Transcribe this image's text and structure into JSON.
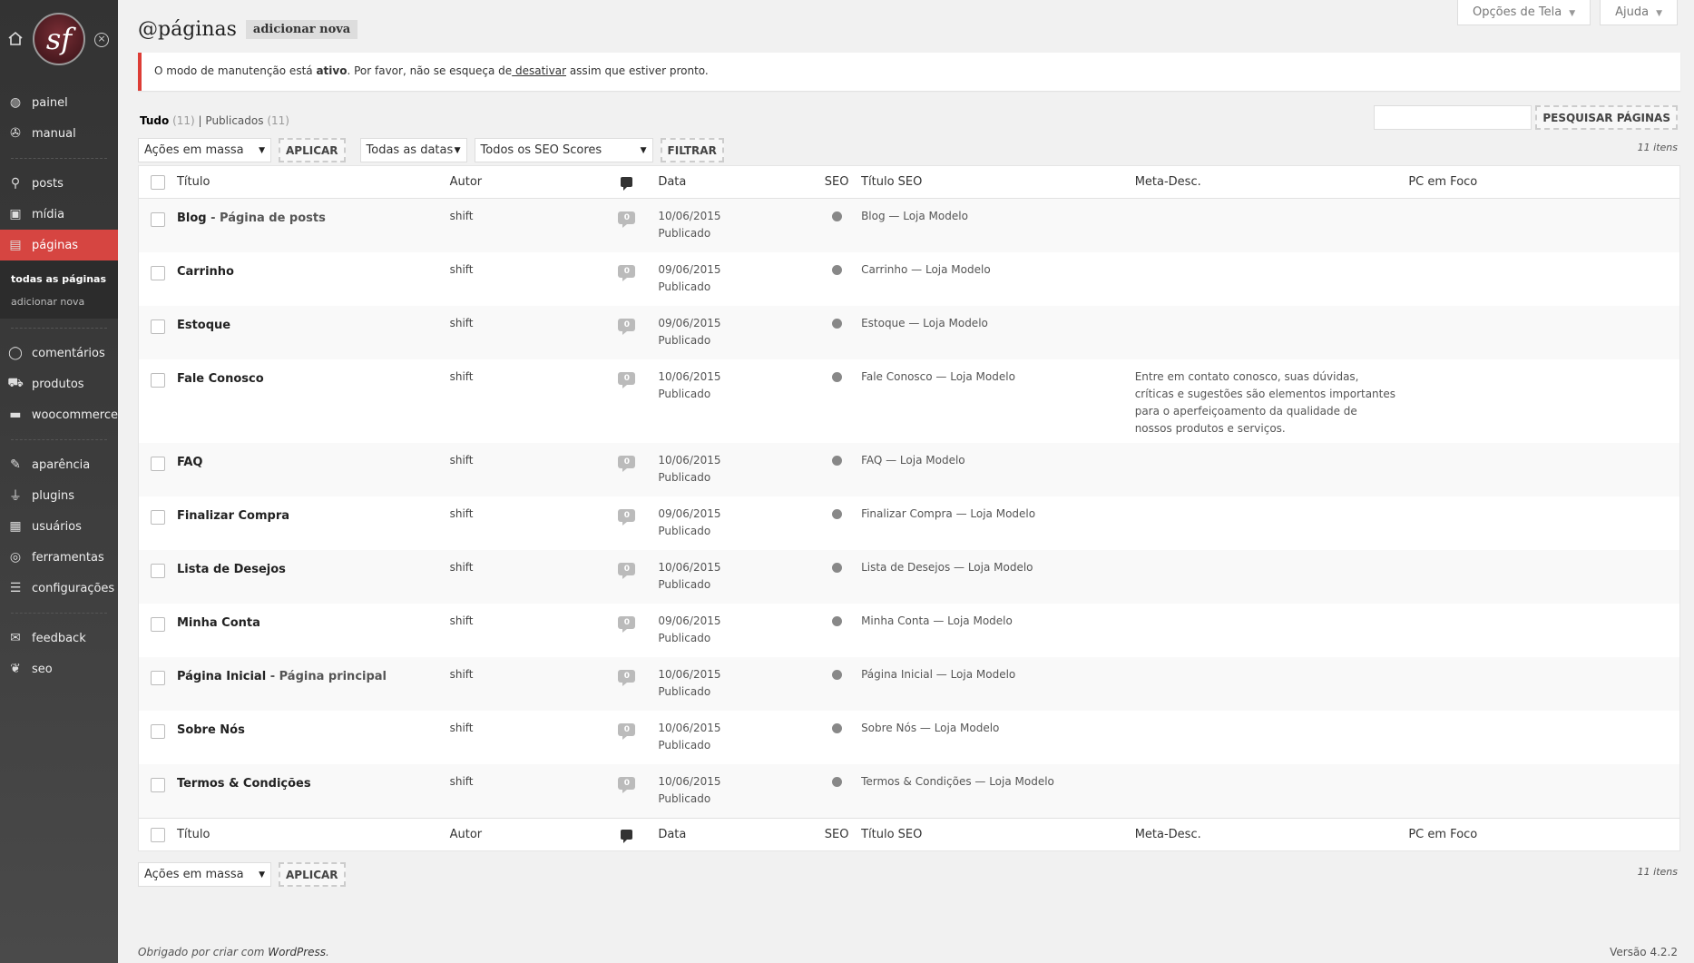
{
  "sidebar": {
    "logo_text": "sf",
    "groups": [
      [
        {
          "label": "painel",
          "icon": "globe-icon"
        },
        {
          "label": "manual",
          "icon": "lifebuoy-icon"
        }
      ],
      [
        {
          "label": "posts",
          "icon": "pin-icon"
        },
        {
          "label": "mídia",
          "icon": "media-icon"
        },
        {
          "label": "páginas",
          "icon": "page-icon",
          "active": true
        }
      ],
      [
        {
          "label": "comentários",
          "icon": "comment-icon"
        },
        {
          "label": "produtos",
          "icon": "cart-icon"
        },
        {
          "label": "woocommerce",
          "icon": "woo-icon"
        }
      ],
      [
        {
          "label": "aparência",
          "icon": "brush-icon"
        },
        {
          "label": "plugins",
          "icon": "plug-icon"
        },
        {
          "label": "usuários",
          "icon": "users-icon"
        },
        {
          "label": "ferramentas",
          "icon": "compass-icon"
        },
        {
          "label": "configurações",
          "icon": "sliders-icon"
        }
      ],
      [
        {
          "label": "feedback",
          "icon": "mail-icon"
        },
        {
          "label": "seo",
          "icon": "seo-icon"
        }
      ]
    ],
    "submenu": [
      "todas as páginas",
      "adicionar nova"
    ]
  },
  "header": {
    "title": "@páginas",
    "add_new": "adicionar nova",
    "screen_options": "Opções de Tela",
    "help": "Ajuda"
  },
  "notice": {
    "part1": "O modo de manutenção está ",
    "bold": "ativo",
    "part2": ". Por favor, não se esqueça de",
    "link": " desativar",
    "part3": " assim que estiver pronto."
  },
  "filters": {
    "all_label": "Tudo",
    "all_count": "(11)",
    "sep": "|",
    "published_label": "Publicados",
    "published_count": "(11)",
    "bulk_actions": "Ações em massa",
    "apply": "APLICAR",
    "all_dates": "Todas as datas",
    "seo_scores": "Todos os SEO Scores",
    "filter": "FILTRAR",
    "search_button": "PESQUISAR PÁGINAS",
    "items_count": "11 itens"
  },
  "columns": {
    "title": "Título",
    "author": "Autor",
    "date": "Data",
    "seo": "SEO",
    "seo_title": "Título SEO",
    "meta_desc": "Meta-Desc.",
    "pc_focus": "PC em Foco"
  },
  "rows": [
    {
      "title": "Blog",
      "state": " - Página de posts",
      "author": "shift",
      "comments": "0",
      "date": "10/06/2015",
      "status": "Publicado",
      "seo_title": "Blog — Loja Modelo",
      "meta": "",
      "pc": ""
    },
    {
      "title": "Carrinho",
      "state": "",
      "author": "shift",
      "comments": "0",
      "date": "09/06/2015",
      "status": "Publicado",
      "seo_title": "Carrinho — Loja Modelo",
      "meta": "",
      "pc": ""
    },
    {
      "title": "Estoque",
      "state": "",
      "author": "shift",
      "comments": "0",
      "date": "09/06/2015",
      "status": "Publicado",
      "seo_title": "Estoque — Loja Modelo",
      "meta": "",
      "pc": ""
    },
    {
      "title": "Fale Conosco",
      "state": "",
      "author": "shift",
      "comments": "0",
      "date": "10/06/2015",
      "status": "Publicado",
      "seo_title": "Fale Conosco — Loja Modelo",
      "meta": "Entre em contato conosco, suas dúvidas, críticas e sugestões são elementos importantes para o aperfeiçoamento da qualidade de nossos produtos e serviços.",
      "pc": ""
    },
    {
      "title": "FAQ",
      "state": "",
      "author": "shift",
      "comments": "0",
      "date": "10/06/2015",
      "status": "Publicado",
      "seo_title": "FAQ — Loja Modelo",
      "meta": "",
      "pc": ""
    },
    {
      "title": "Finalizar Compra",
      "state": "",
      "author": "shift",
      "comments": "0",
      "date": "09/06/2015",
      "status": "Publicado",
      "seo_title": "Finalizar Compra — Loja Modelo",
      "meta": "",
      "pc": ""
    },
    {
      "title": "Lista de Desejos",
      "state": "",
      "author": "shift",
      "comments": "0",
      "date": "10/06/2015",
      "status": "Publicado",
      "seo_title": "Lista de Desejos — Loja Modelo",
      "meta": "",
      "pc": ""
    },
    {
      "title": "Minha Conta",
      "state": "",
      "author": "shift",
      "comments": "0",
      "date": "09/06/2015",
      "status": "Publicado",
      "seo_title": "Minha Conta — Loja Modelo",
      "meta": "",
      "pc": ""
    },
    {
      "title": "Página Inicial",
      "state": " - Página principal",
      "author": "shift",
      "comments": "0",
      "date": "10/06/2015",
      "status": "Publicado",
      "seo_title": "Página Inicial — Loja Modelo",
      "meta": "",
      "pc": ""
    },
    {
      "title": "Sobre Nós",
      "state": "",
      "author": "shift",
      "comments": "0",
      "date": "10/06/2015",
      "status": "Publicado",
      "seo_title": "Sobre Nós — Loja Modelo",
      "meta": "",
      "pc": ""
    },
    {
      "title": "Termos & Condições",
      "state": "",
      "author": "shift",
      "comments": "0",
      "date": "10/06/2015",
      "status": "Publicado",
      "seo_title": "Termos & Condições — Loja Modelo",
      "meta": "",
      "pc": ""
    }
  ],
  "footer": {
    "thanks": "Obrigado por criar com ",
    "wordpress": "WordPress",
    "dot": ".",
    "version": "Versão 4.2.2"
  },
  "colors": {
    "active_menu": "#d64541",
    "notice_border": "#dd3d36",
    "seo_dot": "#888888"
  }
}
